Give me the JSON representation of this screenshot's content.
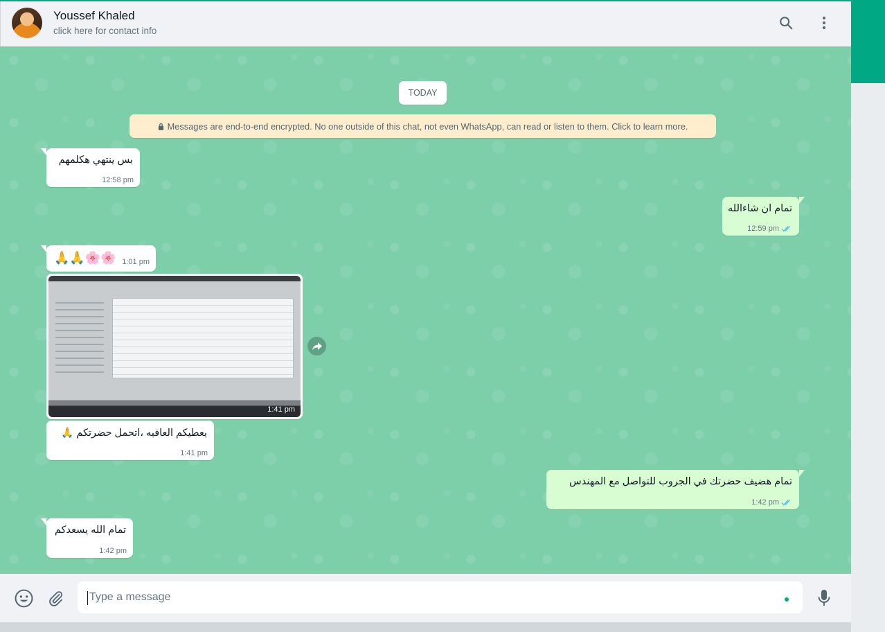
{
  "header": {
    "contact_name": "Youssef Khaled",
    "contact_subtitle": "click here for contact info",
    "icons": [
      "search-icon",
      "menu-icon"
    ]
  },
  "chat": {
    "date_chip": "TODAY",
    "encryption_notice": "Messages are end-to-end encrypted. No one outside of this chat, not even WhatsApp, can read or listen to them. Click to learn more.",
    "messages": [
      {
        "direction": "in",
        "text": "بس ينتهي هكلمهم",
        "time": "12:58 pm"
      },
      {
        "direction": "out",
        "text": "تمام ان شاءالله",
        "time": "12:59 pm",
        "status": "read"
      },
      {
        "direction": "in",
        "text": "🙏🙏🌸🌸",
        "time": "1:01 pm"
      },
      {
        "direction": "in",
        "type": "image",
        "time": "1:41 pm"
      },
      {
        "direction": "in",
        "text": "يعطيكم العافيه ،اتحمل حضرتكم 🙏",
        "time": "1:41 pm"
      },
      {
        "direction": "out",
        "text": "تمام هضيف حضرتك في الجروب للتواصل مع المهندس",
        "time": "1:42 pm",
        "status": "read"
      },
      {
        "direction": "in",
        "text": "تمام الله يسعدكم",
        "time": "1:42 pm"
      }
    ]
  },
  "composer": {
    "placeholder": "Type a message",
    "icons": [
      "emoji-icon",
      "attach-icon",
      "microphone-icon"
    ]
  },
  "colors": {
    "accent": "#00a884",
    "chat_background": "#7dcfaa",
    "incoming_bubble": "#ffffff",
    "outgoing_bubble": "#d9fdd3",
    "encryption_banner": "#ffeecd",
    "read_ticks": "#53bdeb"
  }
}
